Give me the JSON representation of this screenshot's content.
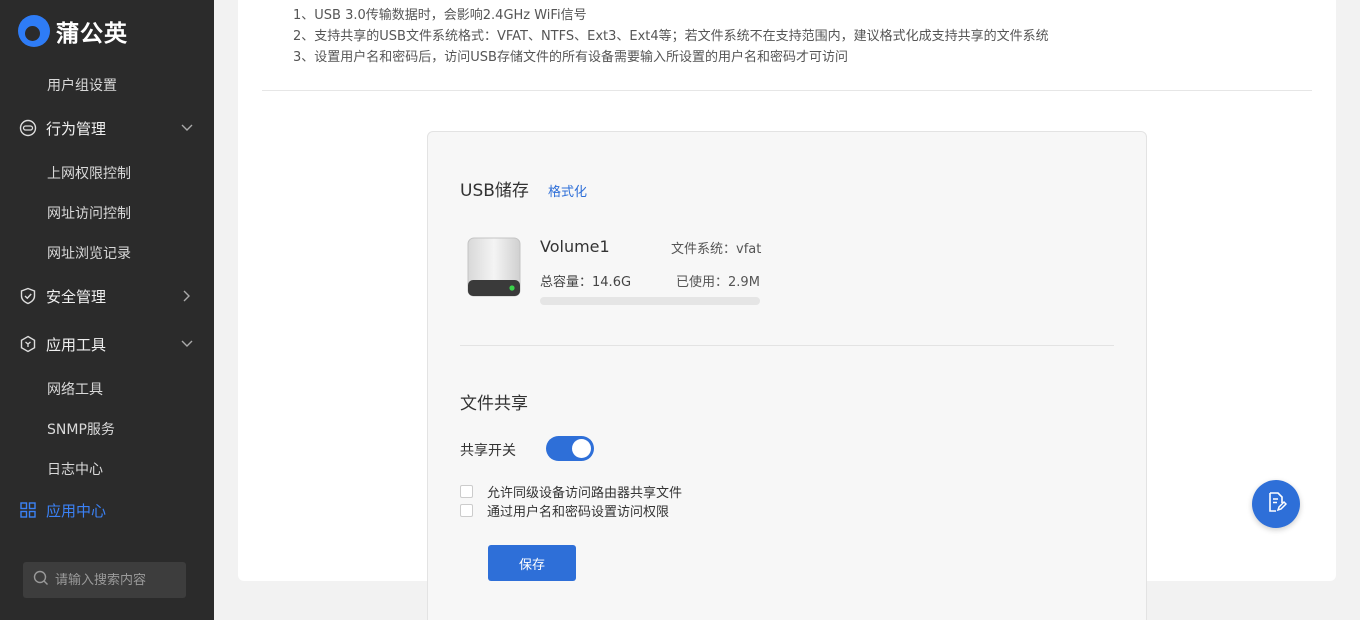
{
  "brand": {
    "name": "蒲公英",
    "accent": "#2e7cf6"
  },
  "sidebar": {
    "items": [
      {
        "type": "sub",
        "label": "用户组设置"
      },
      {
        "type": "group",
        "label": "行为管理",
        "icon": "behavior-icon",
        "expanded": true
      },
      {
        "type": "sub",
        "label": "上网权限控制"
      },
      {
        "type": "sub",
        "label": "网址访问控制"
      },
      {
        "type": "sub",
        "label": "网址浏览记录"
      },
      {
        "type": "group",
        "label": "安全管理",
        "icon": "shield-icon",
        "expanded": false
      },
      {
        "type": "group",
        "label": "应用工具",
        "icon": "tools-icon",
        "expanded": true
      },
      {
        "type": "sub",
        "label": "网络工具"
      },
      {
        "type": "sub",
        "label": "SNMP服务"
      },
      {
        "type": "sub",
        "label": "日志中心"
      },
      {
        "type": "group",
        "label": "应用中心",
        "icon": "grid-icon",
        "active": true
      }
    ],
    "search": {
      "placeholder": "请输入搜索内容"
    }
  },
  "notes": [
    "1、USB 3.0传输数据时，会影响2.4GHz WiFi信号",
    "2、支持共享的USB文件系统格式：VFAT、NTFS、Ext3、Ext4等；若文件系统不在支持范围内，建议格式化成支持共享的文件系统",
    "3、设置用户名和密码后，访问USB存储文件的所有设备需要输入所设置的用户名和密码才可访问"
  ],
  "usb": {
    "title": "USB储存",
    "format_link": "格式化",
    "volume": "Volume1",
    "fs_label": "文件系统：",
    "fs_value": "vfat",
    "capacity_label": "总容量：",
    "capacity_value": "14.6G",
    "used_label": "已使用：",
    "used_value": "2.9M",
    "used_fraction": 0.0002
  },
  "sharing": {
    "title": "文件共享",
    "toggle_label": "共享开关",
    "toggle_on": true,
    "options": [
      {
        "label": "允许同级设备访问路由器共享文件",
        "checked": false
      },
      {
        "label": "通过用户名和密码设置访问权限",
        "checked": false
      }
    ],
    "save_label": "保存"
  }
}
